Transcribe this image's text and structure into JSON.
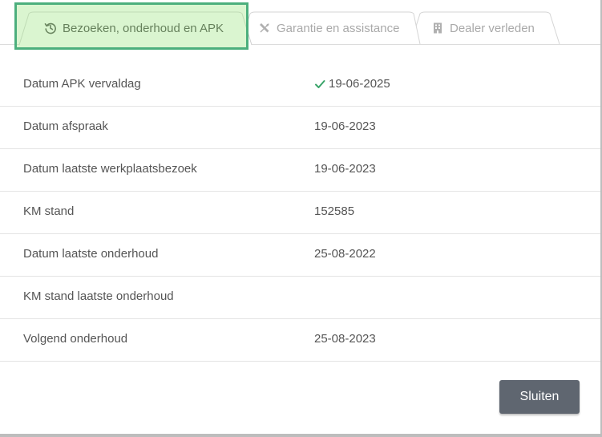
{
  "tabs": [
    {
      "label": "Bezoeken, onderhoud en APK",
      "icon": "history-icon",
      "active": true
    },
    {
      "label": "Garantie en assistance",
      "icon": "tools-icon",
      "active": false
    },
    {
      "label": "Dealer verleden",
      "icon": "building-icon",
      "active": false
    }
  ],
  "details": [
    {
      "label": "Datum APK vervaldag",
      "value": "19-06-2025",
      "status": "check-icon"
    },
    {
      "label": "Datum afspraak",
      "value": "19-06-2023"
    },
    {
      "label": "Datum laatste werkplaatsbezoek",
      "value": "19-06-2023"
    },
    {
      "label": "KM stand",
      "value": "152585"
    },
    {
      "label": "Datum laatste onderhoud",
      "value": "25-08-2022"
    },
    {
      "label": "KM stand laatste onderhoud",
      "value": ""
    },
    {
      "label": "Volgend onderhoud",
      "value": "25-08-2023"
    }
  ],
  "footer": {
    "close_label": "Sluiten"
  },
  "colors": {
    "check": "#3aa46a",
    "button_bg": "#5f6670",
    "highlight_border": "#4caf7d"
  }
}
